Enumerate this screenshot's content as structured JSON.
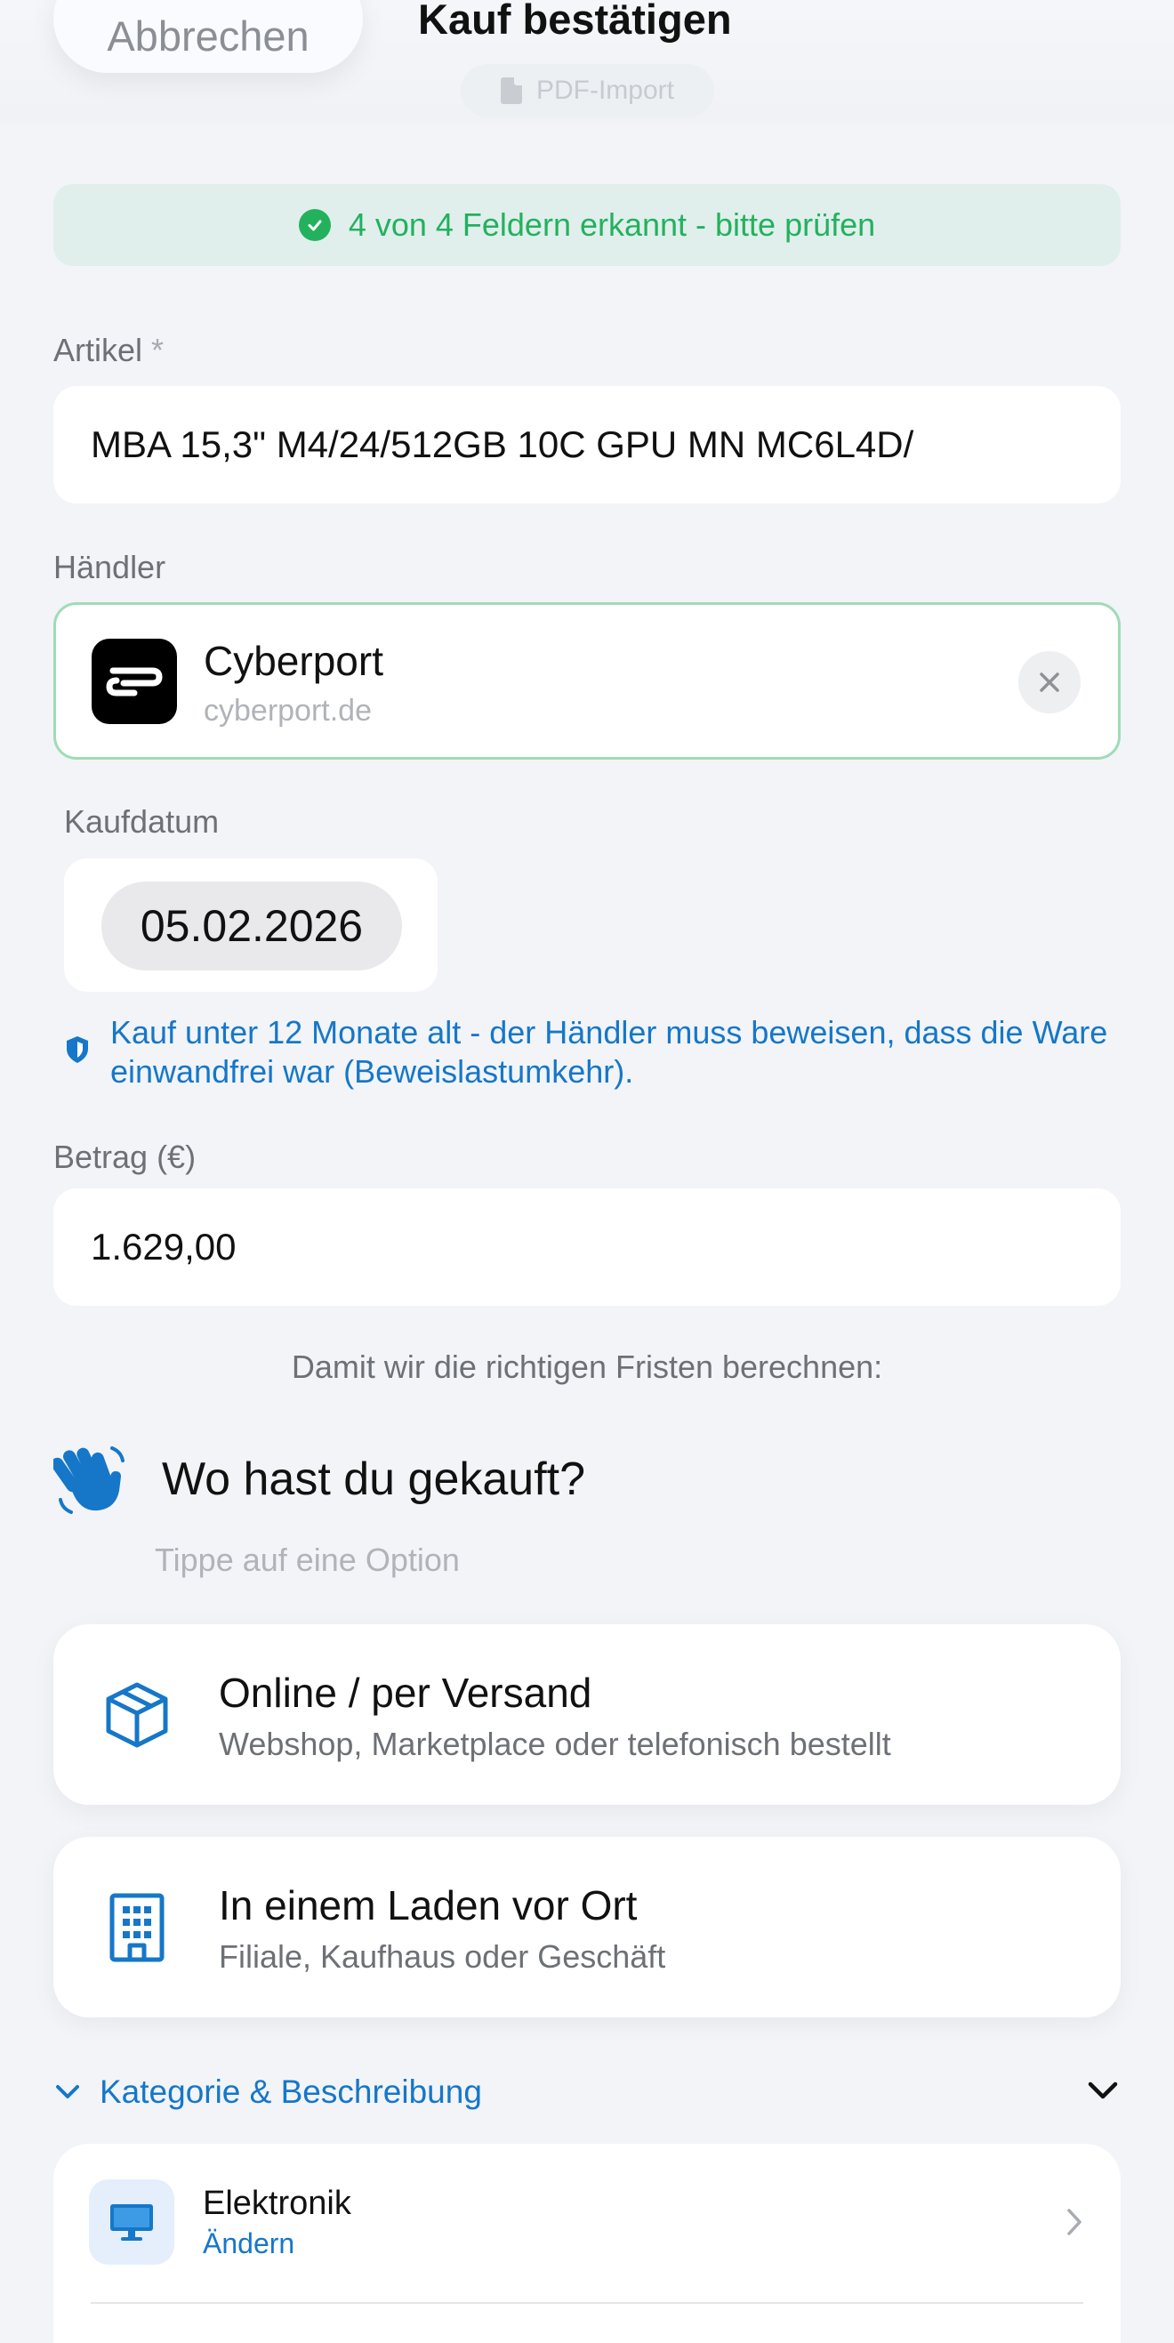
{
  "header": {
    "cancel_label": "Abbrechen",
    "title": "Kauf bestätigen",
    "import_badge": "PDF-Import"
  },
  "banner": {
    "text": "4 von 4 Feldern erkannt - bitte prüfen",
    "color": "#23b15e"
  },
  "fields": {
    "article": {
      "label": "Artikel",
      "required_mark": "*",
      "value": "MBA 15,3\" M4/24/512GB 10C GPU MN MC6L4D/"
    },
    "merchant": {
      "label": "Händler",
      "name": "Cyberport",
      "domain": "cyberport.de"
    },
    "date": {
      "label": "Kaufdatum",
      "value": "05.02.2026"
    },
    "notice": "Kauf unter 12 Monate alt - der Händler muss beweisen, dass die Ware einwandfrei war (Beweislastumkehr).",
    "amount": {
      "label": "Betrag (€)",
      "value": "1.629,00"
    }
  },
  "purchase_type": {
    "intro": "Damit wir die richtigen Fristen berechnen:",
    "question": "Wo hast du gekauft?",
    "hint": "Tippe auf eine Option",
    "options": [
      {
        "title": "Online / per Versand",
        "description": "Webshop, Marketplace oder telefonisch bestellt",
        "icon": "package-icon"
      },
      {
        "title": "In einem Laden vor Ort",
        "description": "Filiale, Kaufhaus oder Geschäft",
        "icon": "building-icon"
      }
    ]
  },
  "category_section": {
    "toggle_label": "Kategorie & Beschreibung",
    "category": {
      "name": "Elektronik",
      "change_label": "Ändern",
      "icon": "monitor-icon"
    }
  },
  "colors": {
    "accent": "#1677c8",
    "success": "#23b15e",
    "background": "#f2f4f8"
  }
}
